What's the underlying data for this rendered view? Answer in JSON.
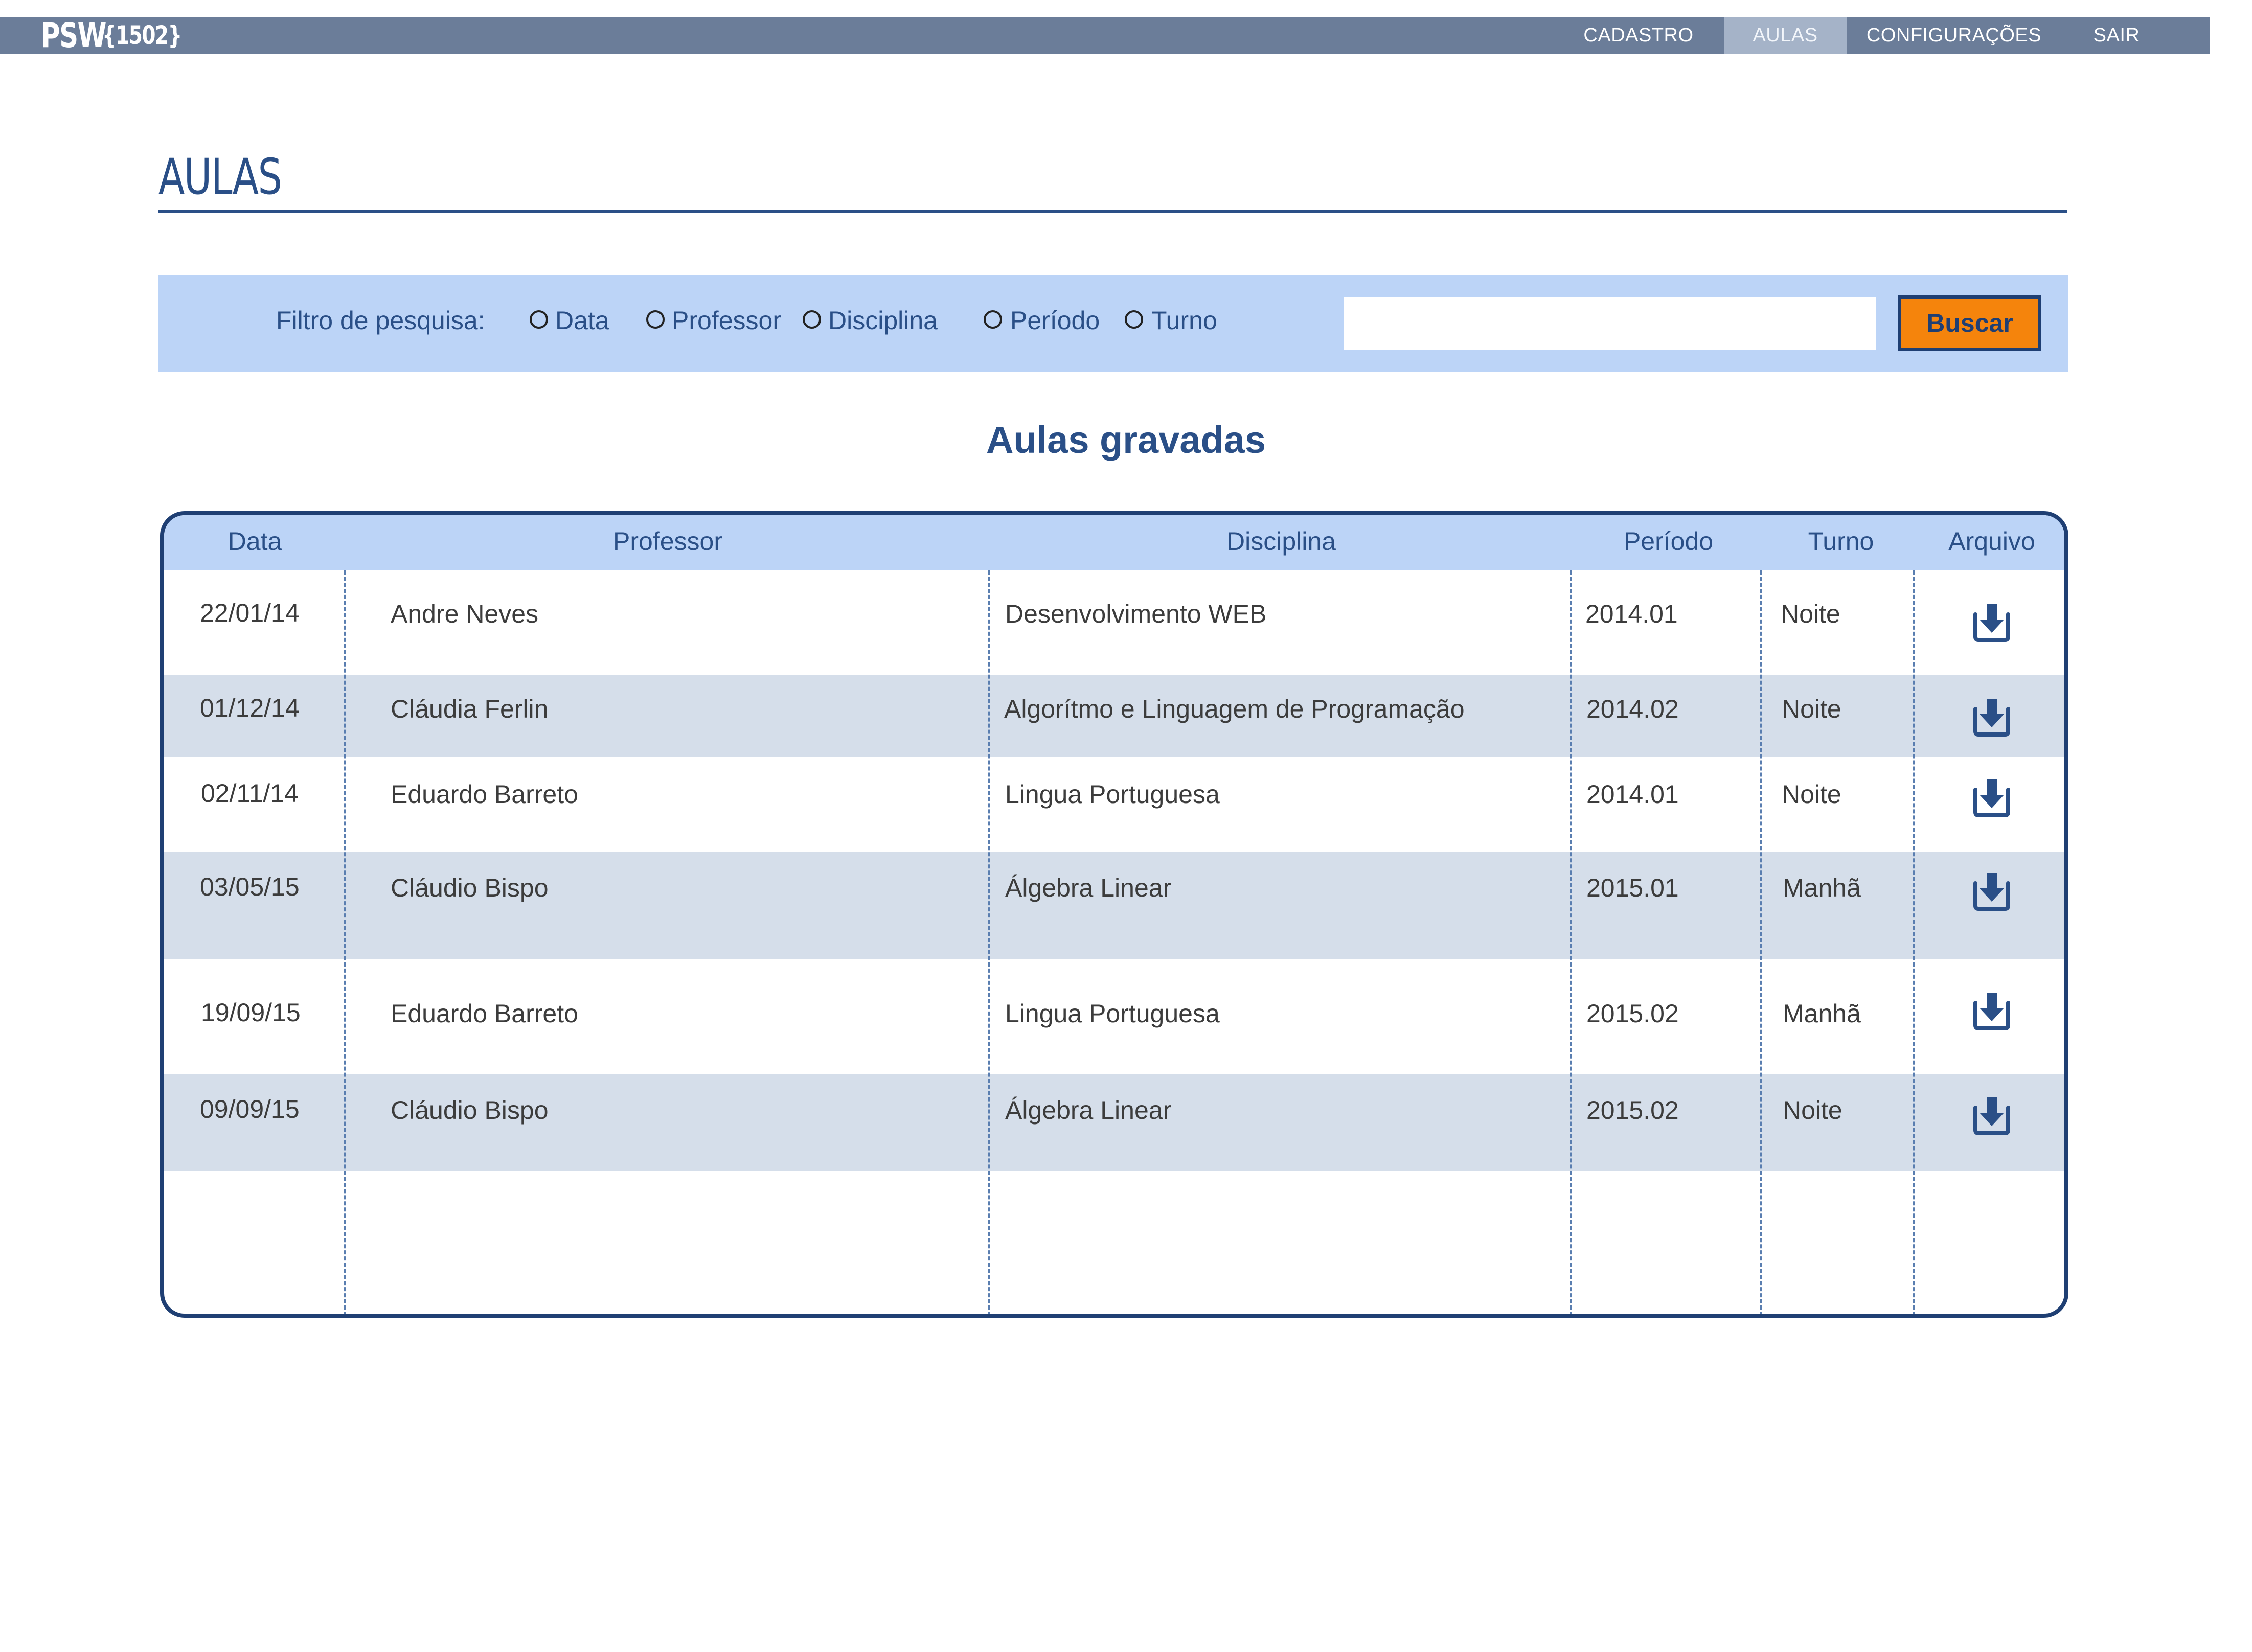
{
  "app": {
    "logo_psw": "PSW",
    "logo_code": "{1502}"
  },
  "nav": [
    {
      "label": "CADASTRO",
      "active": false
    },
    {
      "label": "AULAS",
      "active": true
    },
    {
      "label": "CONFIGURAÇÕES",
      "active": false
    },
    {
      "label": "SAIR",
      "active": false
    }
  ],
  "page": {
    "title": "AULAS",
    "section_title": "Aulas gravadas"
  },
  "filter": {
    "label": "Filtro de pesquisa:",
    "options": [
      "Data",
      "Professor",
      "Disciplina",
      "Período",
      "Turno"
    ],
    "search_value": "",
    "search_placeholder": "",
    "button_label": "Buscar"
  },
  "table": {
    "columns": [
      "Data",
      "Professor",
      "Disciplina",
      "Período",
      "Turno",
      "Arquivo"
    ],
    "rows": [
      {
        "data": "22/01/14",
        "professor": "Andre Neves",
        "disciplina": "Desenvolvimento WEB",
        "periodo": "2014.01",
        "turno": "Noite"
      },
      {
        "data": "01/12/14",
        "professor": "Cláudia Ferlin",
        "disciplina": "Algorítmo e Linguagem de Programação",
        "periodo": "2014.02",
        "turno": "Noite"
      },
      {
        "data": "02/11/14",
        "professor": "Eduardo Barreto",
        "disciplina": "Lingua Portuguesa",
        "periodo": "2014.01",
        "turno": "Noite"
      },
      {
        "data": "03/05/15",
        "professor": "Cláudio Bispo",
        "disciplina": "Álgebra Linear",
        "periodo": "2015.01",
        "turno": "Manhã"
      },
      {
        "data": "19/09/15",
        "professor": "Eduardo Barreto",
        "disciplina": "Lingua Portuguesa",
        "periodo": "2015.02",
        "turno": "Manhã"
      },
      {
        "data": "09/09/15",
        "professor": "Cláudio Bispo",
        "disciplina": "Álgebra Linear",
        "periodo": "2015.02",
        "turno": "Noite"
      }
    ],
    "download_icon": "download-icon"
  },
  "colors": {
    "topbar": "#6b7d99",
    "nav_active": "#a5b3c8",
    "primary": "#2a4f87",
    "border": "#1f3f73",
    "filter_bg": "#bcd4f7",
    "row_shade": "#d5deea",
    "button": "#f5840c"
  }
}
